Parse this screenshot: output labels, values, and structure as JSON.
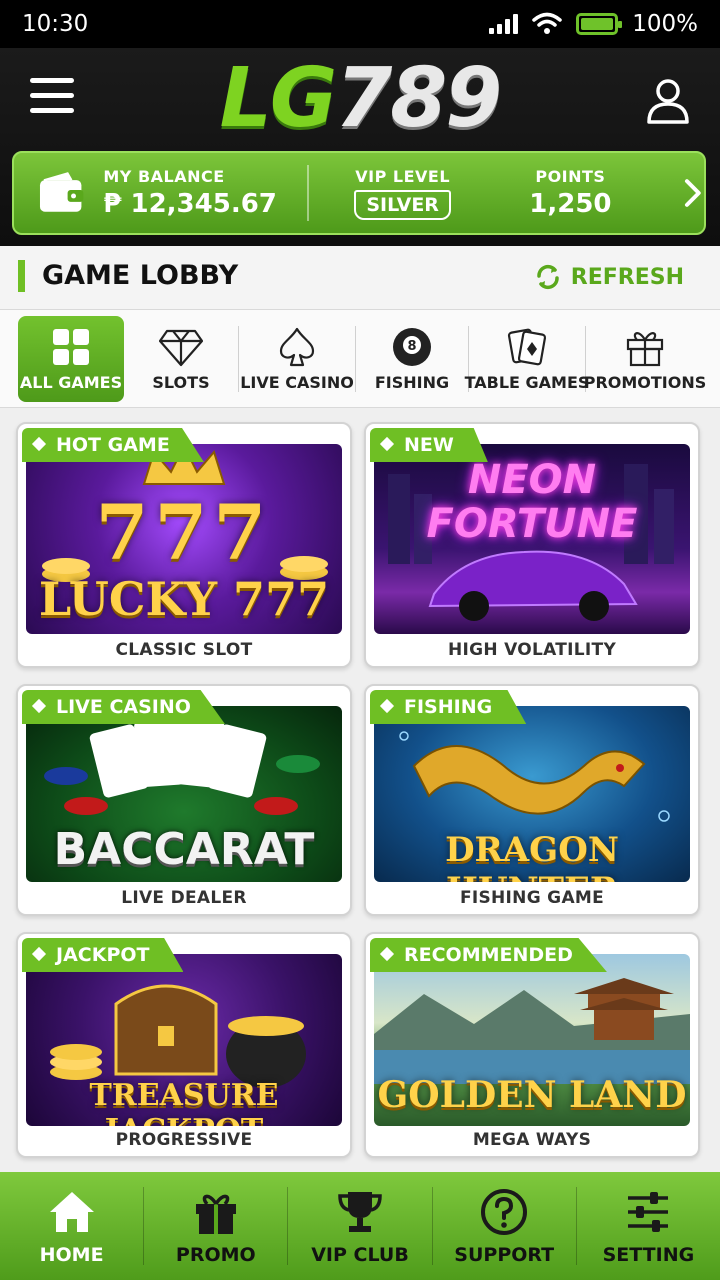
{
  "status_bar": {
    "time": "10:30",
    "battery": "100%",
    "battery_level": 1.0
  },
  "header": {
    "logo_lg": "LG",
    "logo_num": "789",
    "balance_label": "MY BALANCE",
    "balance_value": "₱ 12,345.67",
    "vip_label": "VIP LEVEL",
    "vip_value": "SILVER",
    "points_label": "POINTS",
    "points_value": "1,250"
  },
  "lobby": {
    "title": "GAME LOBBY",
    "refresh_label": "REFRESH"
  },
  "categories": [
    {
      "label": "ALL GAMES",
      "icon": "grid-icon",
      "active": true
    },
    {
      "label": "SLOTS",
      "icon": "diamond-icon"
    },
    {
      "label": "LIVE CASINO",
      "icon": "spade-icon"
    },
    {
      "label": "FISHING",
      "icon": "eight-ball-icon"
    },
    {
      "label": "TABLE GAMES",
      "icon": "cards-icon"
    },
    {
      "label": "PROMOTIONS",
      "icon": "gift-icon"
    }
  ],
  "games": [
    {
      "tag": "HOT GAME",
      "title": "LUCKY 777",
      "art": "777",
      "subtitle": "CLASSIC SLOT"
    },
    {
      "tag": "NEW",
      "title": "NEON FORTUNE",
      "subtitle": "HIGH VOLATILITY"
    },
    {
      "tag": "LIVE CASINO",
      "title": "BACCARAT",
      "subtitle": "LIVE DEALER"
    },
    {
      "tag": "FISHING",
      "title": "DRAGON HUNTER",
      "subtitle": "FISHING GAME"
    },
    {
      "tag": "JACKPOT",
      "title": "TREASURE JACKPOT",
      "subtitle": "PROGRESSIVE"
    },
    {
      "tag": "RECOMMENDED",
      "title": "GOLDEN LAND",
      "subtitle": "MEGA WAYS"
    }
  ],
  "bottom_nav": [
    {
      "label": "HOME",
      "icon": "home-icon",
      "active": true
    },
    {
      "label": "PROMO",
      "icon": "gift-icon"
    },
    {
      "label": "VIP CLUB",
      "icon": "trophy-icon"
    },
    {
      "label": "SUPPORT",
      "icon": "question-icon"
    },
    {
      "label": "SETTING",
      "icon": "sliders-icon"
    }
  ],
  "colors": {
    "accent": "#6fbf24",
    "header_bg": "#111111",
    "page_bg": "#efefef"
  }
}
